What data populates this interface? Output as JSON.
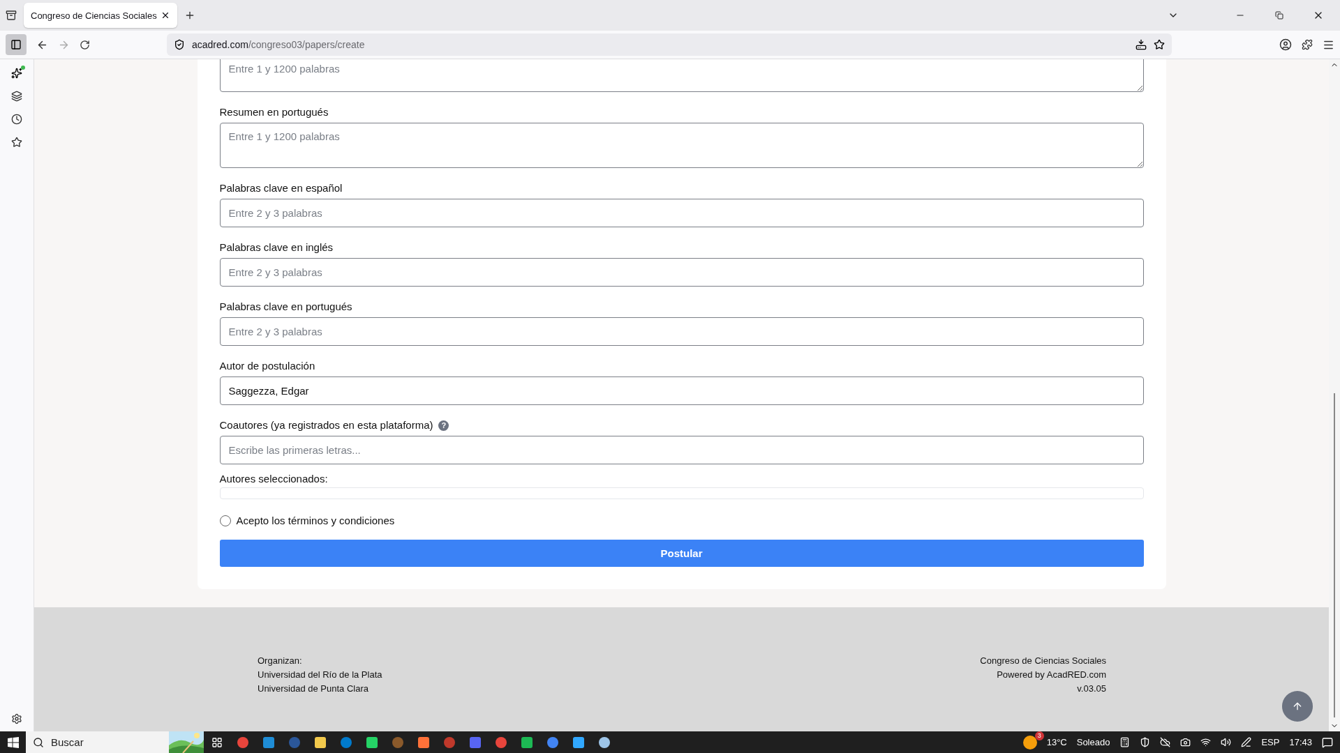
{
  "browser": {
    "tab_title": "Congreso de Ciencias Sociales",
    "url": {
      "domain": "acadred.com",
      "path": "/congreso03/papers/create"
    }
  },
  "form": {
    "fields": [
      {
        "kind": "textarea",
        "placeholder": "Entre 1 y 1200 palabras"
      },
      {
        "kind": "textarea",
        "label": "Resumen en portugués",
        "placeholder": "Entre 1 y 1200 palabras"
      },
      {
        "kind": "input",
        "label": "Palabras clave en español",
        "placeholder": "Entre 2 y 3 palabras"
      },
      {
        "kind": "input",
        "label": "Palabras clave en inglés",
        "placeholder": "Entre 2 y 3 palabras"
      },
      {
        "kind": "input",
        "label": "Palabras clave en portugués",
        "placeholder": "Entre 2 y 3 palabras"
      },
      {
        "kind": "input",
        "label": "Autor de postulación",
        "value": "Saggezza, Edgar"
      },
      {
        "kind": "input",
        "label": "Coautores (ya registrados en esta plataforma)",
        "help": "?",
        "placeholder": "Escribe las primeras letras..."
      }
    ],
    "selected_authors": {
      "label": "Autores seleccionados:"
    },
    "terms": {
      "label": "Acepto los términos y condiciones",
      "checked": false
    },
    "submit": "Postular"
  },
  "footer": {
    "left": [
      "Organizan:",
      "Universidad del Río de la Plata",
      "Universidad de Punta Clara"
    ],
    "right": [
      "Congreso de Ciencias Sociales",
      "Powered by AcadRED.com",
      "v.03.05"
    ]
  },
  "taskbar": {
    "search_placeholder": "Buscar",
    "weather_badge": "3",
    "temperature": "13°C",
    "weather": "Soleado",
    "language": "ESP",
    "time": "17:43"
  }
}
